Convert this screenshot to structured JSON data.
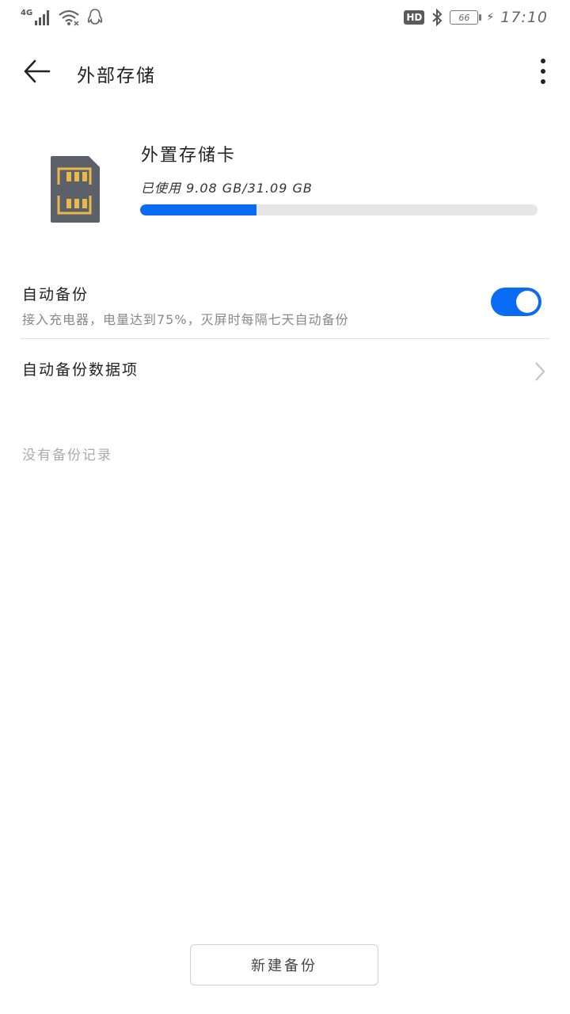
{
  "status_bar": {
    "network": "4G",
    "hd": "HD",
    "battery": "66",
    "time": "17:10"
  },
  "header": {
    "title": "外部存储"
  },
  "storage": {
    "name": "外置存储卡",
    "usage_text": "已使用 9.08 GB/31.09 GB",
    "used_gb": 9.08,
    "total_gb": 31.09
  },
  "auto_backup": {
    "title": "自动备份",
    "subtitle": "接入充电器，电量达到75%，灭屏时每隔七天自动备份",
    "enabled": true
  },
  "auto_backup_items": {
    "title": "自动备份数据项"
  },
  "empty_message": "没有备份记录",
  "new_backup_button": "新建备份",
  "colors": {
    "accent": "#0a6cf5",
    "track": "#e6e6e6"
  }
}
